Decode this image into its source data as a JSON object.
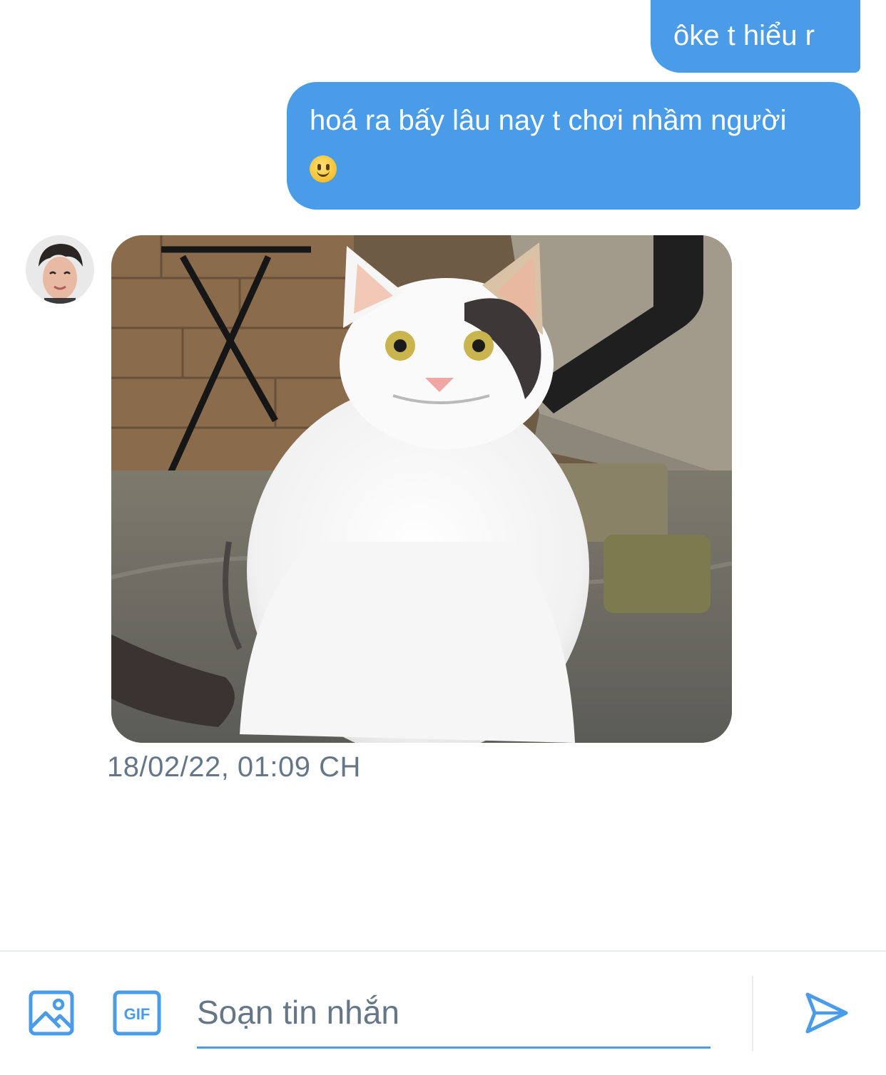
{
  "messages": [
    {
      "direction": "outgoing",
      "text": "ôke t hiểu r"
    },
    {
      "direction": "outgoing",
      "text": "hoá ra bấy lâu nay t chơi nhầm người",
      "emoji": "slightly-smiling-face"
    },
    {
      "direction": "incoming",
      "attachment": "image",
      "attachment_subject": "smiling white cat photo"
    }
  ],
  "timestamp": "18/02/22, 01:09 CH",
  "composer": {
    "placeholder": "Soạn tin nhắn",
    "gif_label": "GIF",
    "icons": [
      "image-icon",
      "gif-icon",
      "send-icon"
    ]
  },
  "colors": {
    "accent": "#4a9be8",
    "bubble_text": "#ffffff",
    "muted_text": "#657786",
    "divider": "#e6ecf0"
  }
}
